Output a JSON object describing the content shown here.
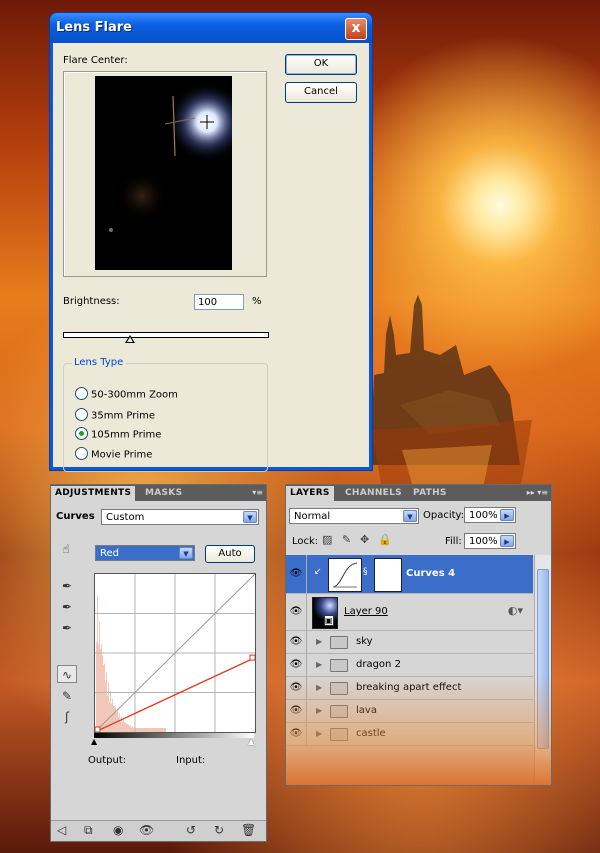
{
  "dialog": {
    "title": "Lens Flare",
    "close_label": "x",
    "flare_center_label": "Flare Center:",
    "ok_label": "OK",
    "cancel_label": "Cancel",
    "brightness_label": "Brightness:",
    "brightness_value": "100",
    "brightness_unit": "%",
    "brightness_slider_fraction": 0.33,
    "lens_type_label": "Lens Type",
    "lens_options": [
      "50-300mm Zoom",
      "35mm Prime",
      "105mm Prime",
      "Movie Prime"
    ],
    "selected_lens": "105mm Prime"
  },
  "adjustments": {
    "tabs": [
      "ADJUSTMENTS",
      "MASKS"
    ],
    "heading": "Curves",
    "preset": "Custom",
    "channel": "Red",
    "auto_label": "Auto",
    "output_label": "Output:",
    "input_label": "Input:",
    "curve_points": [
      [
        0,
        0
      ],
      [
        255,
        120
      ]
    ]
  },
  "layers": {
    "tabs": [
      "LAYERS",
      "CHANNELS",
      "PATHS"
    ],
    "blend_mode": "Normal",
    "opacity_label": "Opacity:",
    "opacity": "100%",
    "lock_label": "Lock:",
    "fill_label": "Fill:",
    "fill": "100%",
    "items": [
      "Curves 4",
      "Layer 90",
      "sky",
      "dragon 2",
      "breaking apart effect",
      "lava",
      "castle"
    ]
  },
  "colors": {
    "selection_blue": "#3b6ec9",
    "curve_red": "#e03a1a",
    "dialog_title": "#0a5fe0"
  },
  "icons": [
    "close-icon",
    "eye-icon",
    "folder-icon",
    "eyedropper-icon",
    "curve-tool-icon",
    "pencil-icon",
    "hand-target-icon",
    "chain-link-icon",
    "trash-icon",
    "reset-icon",
    "lock-icon",
    "move-icon"
  ]
}
